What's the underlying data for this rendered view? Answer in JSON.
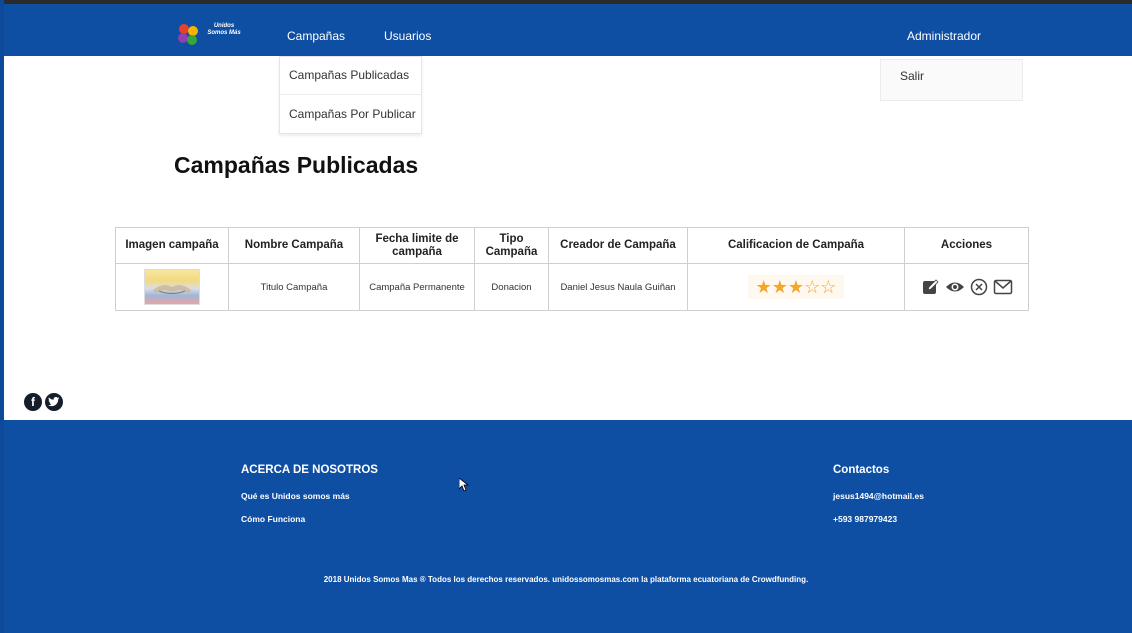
{
  "header": {
    "logo_text_line1": "Unidos",
    "logo_text_line2": "Somos Más",
    "nav": [
      "Campañas",
      "Usuarios"
    ],
    "user_label": "Administrador"
  },
  "campaigns_menu": {
    "items": [
      "Campañas Publicadas",
      "Campañas Por Publicar"
    ]
  },
  "user_menu": {
    "items": [
      "Salir"
    ]
  },
  "main": {
    "title": "Campañas Publicadas"
  },
  "table": {
    "columns": [
      "Imagen campaña",
      "Nombre Campaña",
      "Fecha limite de campaña",
      "Tipo Campaña",
      "Creador de Campaña",
      "Calificacion de Campaña",
      "Acciones"
    ],
    "rows": [
      {
        "image": "campaign-thumbnail",
        "nombre": "Titulo Campaña",
        "fecha": "Campaña Permanente",
        "tipo": "Donacion",
        "creador": "Daniel Jesus Naula Guiñan",
        "rating": 3,
        "rating_max": 5,
        "actions": [
          "edit-icon",
          "view-icon",
          "delete-icon",
          "message-icon"
        ]
      }
    ]
  },
  "social": [
    "facebook-icon",
    "twitter-icon"
  ],
  "footer": {
    "about_title": "ACERCA DE NOSOTROS",
    "about_links": [
      "Qué es Unidos somos más",
      "Cómo Funciona"
    ],
    "contact_title": "Contactos",
    "contact_email": "jesus1494@hotmail.es",
    "contact_phone": "+593 987979423",
    "copyright": "2018 Unidos Somos Mas ® Todos los derechos reservados. unidossomosmas.com la plataforma ecuatoriana de Crowdfunding."
  },
  "colors": {
    "brand_blue": "#0e4fa3",
    "star": "#f5a623"
  }
}
